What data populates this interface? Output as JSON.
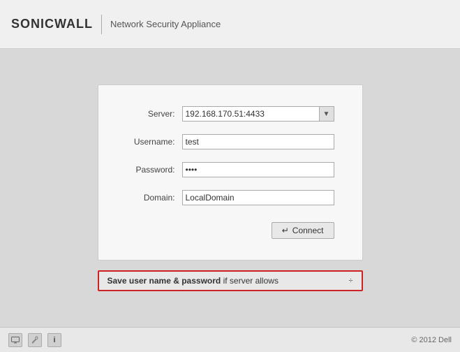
{
  "header": {
    "logo": "SONICWALL",
    "subtitle": "Network Security Appliance"
  },
  "form": {
    "server_label": "Server:",
    "server_value": "192.168.170.51:4433",
    "username_label": "Username:",
    "username_value": "test",
    "password_label": "Password:",
    "password_value": "••••",
    "domain_label": "Domain:",
    "domain_value": "LocalDomain",
    "connect_icon": "↵",
    "connect_label": "Connect"
  },
  "save_button": {
    "label_bold": "Save user name & password",
    "label_suffix": " if server allows",
    "arrow": "÷"
  },
  "footer": {
    "icon1": "⊡",
    "icon2": "🔑",
    "icon3": "ℹ",
    "copyright": "© 2012 Dell"
  }
}
